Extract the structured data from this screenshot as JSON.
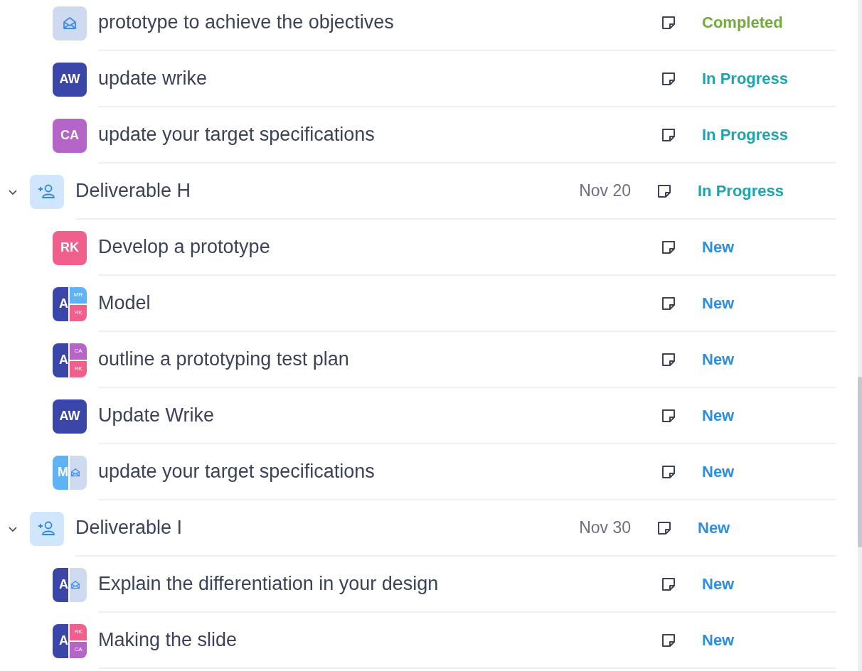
{
  "rows": [
    {
      "kind": "task",
      "title": "prototype to achieve the objectives",
      "avatar": {
        "kind": "icon"
      },
      "status": {
        "label": "Completed",
        "color": "#72ab3c"
      }
    },
    {
      "kind": "task",
      "title": "update wrike",
      "avatar": {
        "kind": "initials",
        "initials": "AW",
        "color": "#3a46a8"
      },
      "status": {
        "label": "In Progress",
        "color": "#1ea3b0"
      }
    },
    {
      "kind": "task",
      "title": "update your target specifications",
      "avatar": {
        "kind": "initials",
        "initials": "CA",
        "color": "#b565c7"
      },
      "status": {
        "label": "In Progress",
        "color": "#1ea3b0"
      }
    },
    {
      "kind": "group",
      "title": "Deliverable H",
      "expanded": true,
      "date": "Nov 20",
      "status": {
        "label": "In Progress",
        "color": "#1ea3b0"
      }
    },
    {
      "kind": "task",
      "title": "Develop a prototype",
      "avatar": {
        "kind": "initials",
        "initials": "RK",
        "color": "#f0608d"
      },
      "status": {
        "label": "New",
        "color": "#2e8ee0"
      }
    },
    {
      "kind": "task",
      "title": "Model",
      "avatar": {
        "kind": "split",
        "initials": "A",
        "color": "#3a46a8",
        "others": [
          {
            "initials": "MR",
            "color": "#5fb3f5"
          },
          {
            "initials": "RK",
            "color": "#f0608d"
          }
        ]
      },
      "status": {
        "label": "New",
        "color": "#2e8ee0"
      }
    },
    {
      "kind": "task",
      "title": "outline a prototyping test plan",
      "avatar": {
        "kind": "split",
        "initials": "A",
        "color": "#3a46a8",
        "others": [
          {
            "initials": "CA",
            "color": "#b565c7"
          },
          {
            "initials": "RK",
            "color": "#f0608d"
          }
        ]
      },
      "status": {
        "label": "New",
        "color": "#2e8ee0"
      }
    },
    {
      "kind": "task",
      "title": "Update Wrike",
      "avatar": {
        "kind": "initials",
        "initials": "AW",
        "color": "#3a46a8"
      },
      "status": {
        "label": "New",
        "color": "#2e8ee0"
      }
    },
    {
      "kind": "task",
      "title": "update your target specifications",
      "avatar": {
        "kind": "split-icon",
        "initials": "M",
        "color": "#5fb3f5"
      },
      "status": {
        "label": "New",
        "color": "#2e8ee0"
      }
    },
    {
      "kind": "group",
      "title": "Deliverable I",
      "expanded": true,
      "date": "Nov 30",
      "status": {
        "label": "New",
        "color": "#2e8ee0"
      }
    },
    {
      "kind": "task",
      "title": "Explain the differentiation in your design",
      "avatar": {
        "kind": "split-icon",
        "initials": "A",
        "color": "#3a46a8"
      },
      "status": {
        "label": "New",
        "color": "#2e8ee0"
      }
    },
    {
      "kind": "task",
      "title": "Making the slide",
      "avatar": {
        "kind": "split",
        "initials": "A",
        "color": "#3a46a8",
        "others": [
          {
            "initials": "RK",
            "color": "#f0608d"
          },
          {
            "initials": "CA",
            "color": "#b565c7"
          }
        ]
      },
      "status": {
        "label": "New",
        "color": "#2e8ee0"
      }
    }
  ]
}
